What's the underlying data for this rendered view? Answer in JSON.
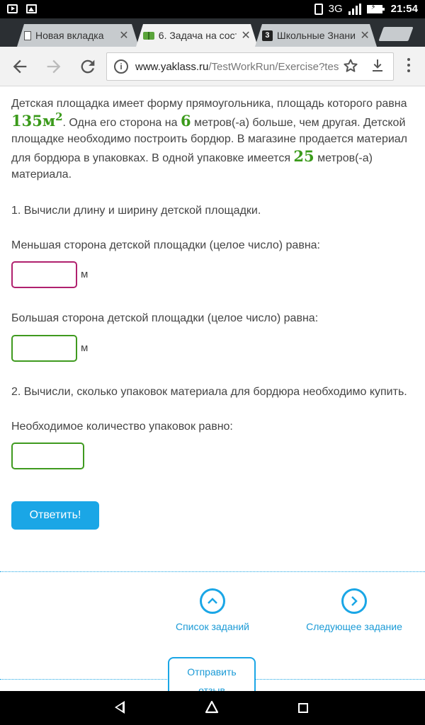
{
  "status_bar": {
    "network": "3G",
    "time": "21:54"
  },
  "tabs": [
    {
      "title": "Новая вкладка",
      "icon": "document-icon",
      "active": false
    },
    {
      "title": "6. Задача на сост",
      "icon": "book-icon",
      "active": true
    },
    {
      "title": "Школьные Знани",
      "icon": "znanija-icon",
      "active": false
    }
  ],
  "tab_close_glyph": "✕",
  "znanija_icon_text": "3",
  "toolbar": {
    "url_host": "www.yaklass.ru",
    "url_path": "/TestWorkRun/Exercise?testR"
  },
  "problem": {
    "t1": "Детская площадка имеет форму прямоугольника, площадь которого равна ",
    "area": "135м",
    "area_exp": "2",
    "t2": ". Одна его сторона на ",
    "diff": "6",
    "t3": " метров(-а) больше, чем другая. Детской площадке необходимо построить бордюр. В магазине продается материал для бордюра в упаковках. В одной упаковке имеется ",
    "pack": "25",
    "t4": " метров(-а) материала."
  },
  "questions": {
    "q1": "1. Вычисли длину и ширину детской площадки.",
    "smaller_label": "Меньшая сторона детской площадки (целое число) равна:",
    "larger_label": "Большая сторона детской площадки (целое число) равна:",
    "unit": "м",
    "q2": "2. Вычисли, сколько упаковок материала для бордюра необходимо купить.",
    "packs_label": "Необходимое количество упаковок равно:"
  },
  "inputs": {
    "smaller": "",
    "larger": "",
    "packs": ""
  },
  "submit_label": "Ответить!",
  "nav": {
    "list_label": "Список заданий",
    "next_label": "Следующее задание",
    "feedback_label_1": "Отправить",
    "feedback_label_2": "отзыв"
  },
  "colors": {
    "accent": "#1aa6e6",
    "math_green": "#3a9a1a",
    "field_green": "#3f9a1f",
    "field_focus": "#b0206e"
  }
}
